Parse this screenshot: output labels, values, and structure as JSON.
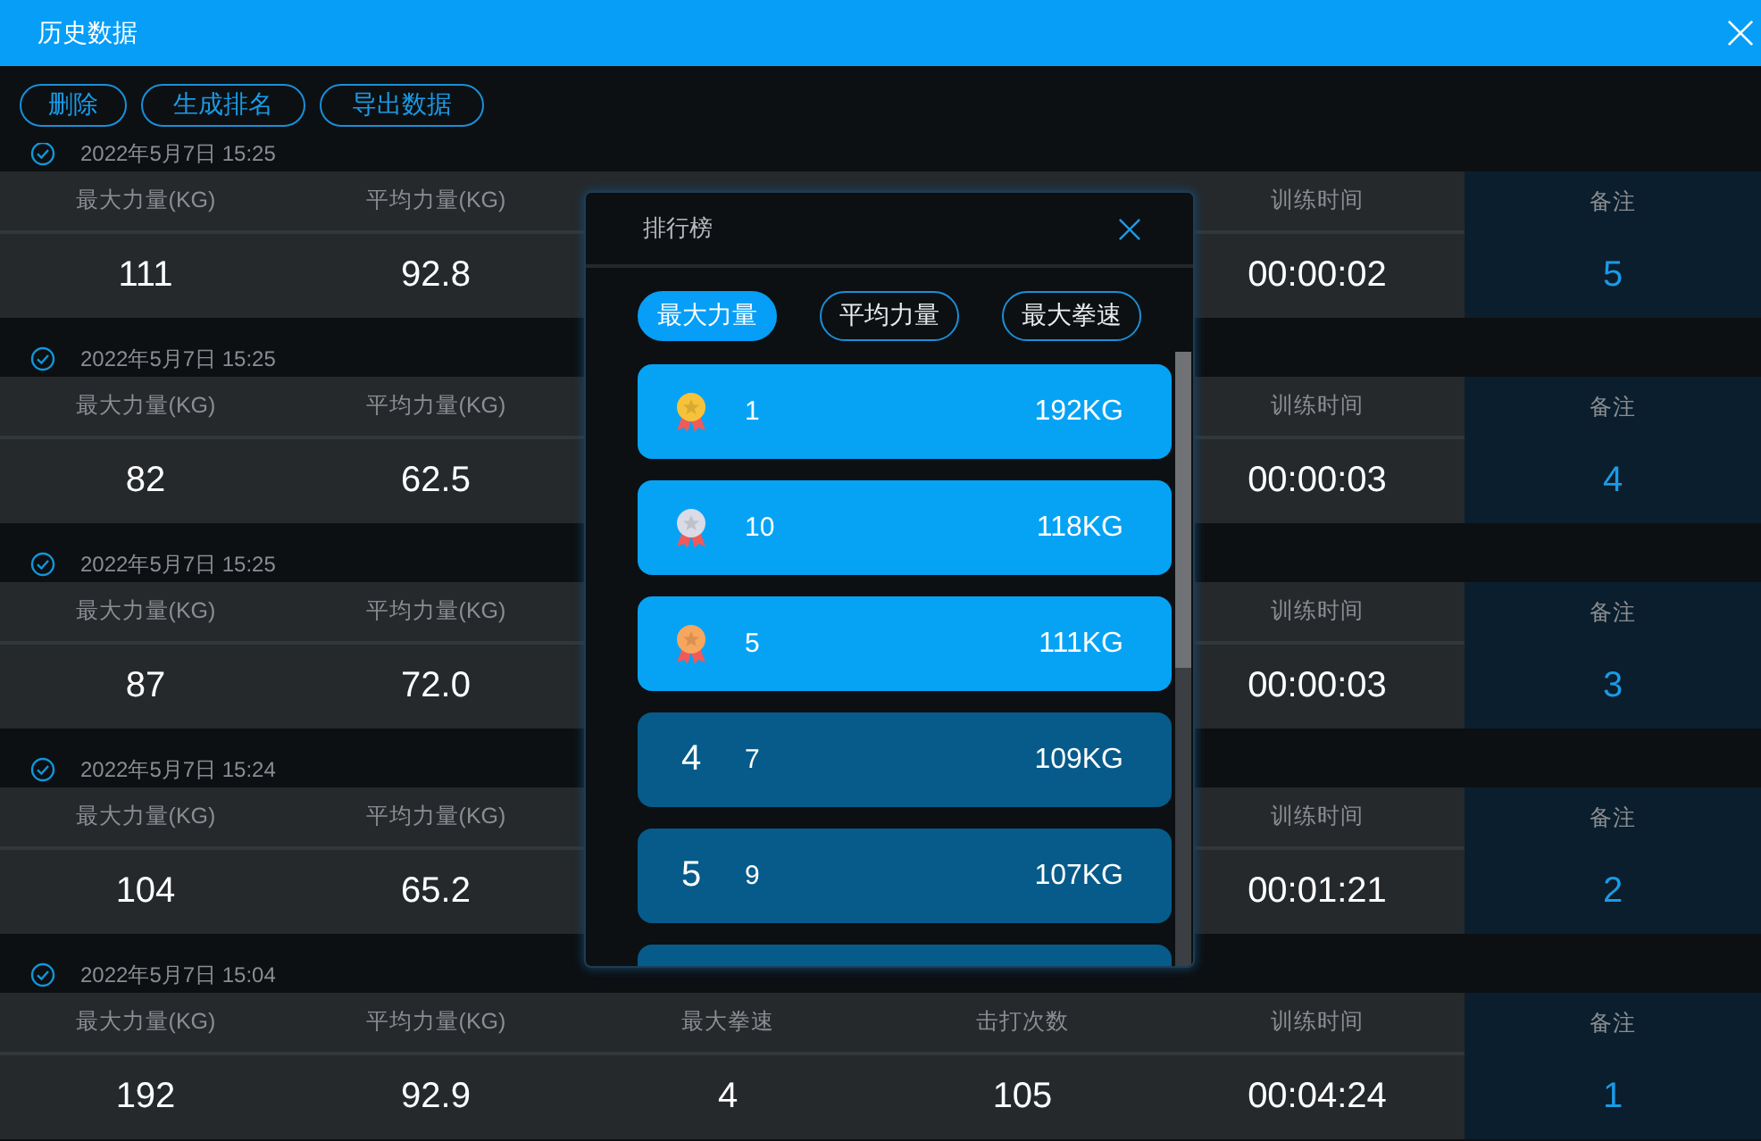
{
  "window": {
    "title": "历史数据"
  },
  "toolbar": [
    "删除",
    "生成排名",
    "导出数据"
  ],
  "records": [
    {
      "date": "2022年5月7日 15:25",
      "checked": true,
      "cells": [
        {
          "header": "最大力量(KG)",
          "value": "111"
        },
        {
          "header": "平均力量(KG)",
          "value": "92.8"
        },
        null,
        null,
        {
          "header": "训练时间",
          "value": "00:00:02"
        },
        {
          "header": "备注",
          "value": "5"
        }
      ]
    },
    {
      "date": "2022年5月7日 15:25",
      "checked": true,
      "cells": [
        {
          "header": "最大力量(KG)",
          "value": "82"
        },
        {
          "header": "平均力量(KG)",
          "value": "62.5"
        },
        null,
        null,
        {
          "header": "训练时间",
          "value": "00:00:03"
        },
        {
          "header": "备注",
          "value": "4"
        }
      ]
    },
    {
      "date": "2022年5月7日 15:25",
      "checked": true,
      "cells": [
        {
          "header": "最大力量(KG)",
          "value": "87"
        },
        {
          "header": "平均力量(KG)",
          "value": "72.0"
        },
        null,
        null,
        {
          "header": "训练时间",
          "value": "00:00:03"
        },
        {
          "header": "备注",
          "value": "3"
        }
      ]
    },
    {
      "date": "2022年5月7日 15:24",
      "checked": true,
      "cells": [
        {
          "header": "最大力量(KG)",
          "value": "104"
        },
        {
          "header": "平均力量(KG)",
          "value": "65.2"
        },
        null,
        null,
        {
          "header": "训练时间",
          "value": "00:01:21"
        },
        {
          "header": "备注",
          "value": "2"
        }
      ]
    },
    {
      "date": "2022年5月7日 15:04",
      "checked": true,
      "cells": [
        {
          "header": "最大力量(KG)",
          "value": "192"
        },
        {
          "header": "平均力量(KG)",
          "value": "92.9"
        },
        {
          "header": "最大拳速",
          "value": "4"
        },
        {
          "header": "击打次数",
          "value": "105"
        },
        {
          "header": "训练时间",
          "value": "00:04:24"
        },
        {
          "header": "备注",
          "value": "1"
        }
      ]
    }
  ],
  "ranking": {
    "title": "排行榜",
    "tabs": [
      {
        "label": "最大力量",
        "selected": true
      },
      {
        "label": "平均力量",
        "selected": false
      },
      {
        "label": "最大拳速",
        "selected": false
      }
    ],
    "items": [
      {
        "kind": "medal",
        "color": "#f6c239",
        "name": "1",
        "score": "192KG"
      },
      {
        "kind": "medal",
        "color": "#d9dbe6",
        "name": "10",
        "score": "118KG"
      },
      {
        "kind": "medal",
        "color": "#f7a65e",
        "name": "5",
        "score": "111KG"
      },
      {
        "kind": "rank",
        "rank": "4",
        "name": "7",
        "score": "109KG"
      },
      {
        "kind": "rank",
        "rank": "5",
        "name": "9",
        "score": "107KG"
      },
      {
        "kind": "rank"
      }
    ]
  }
}
